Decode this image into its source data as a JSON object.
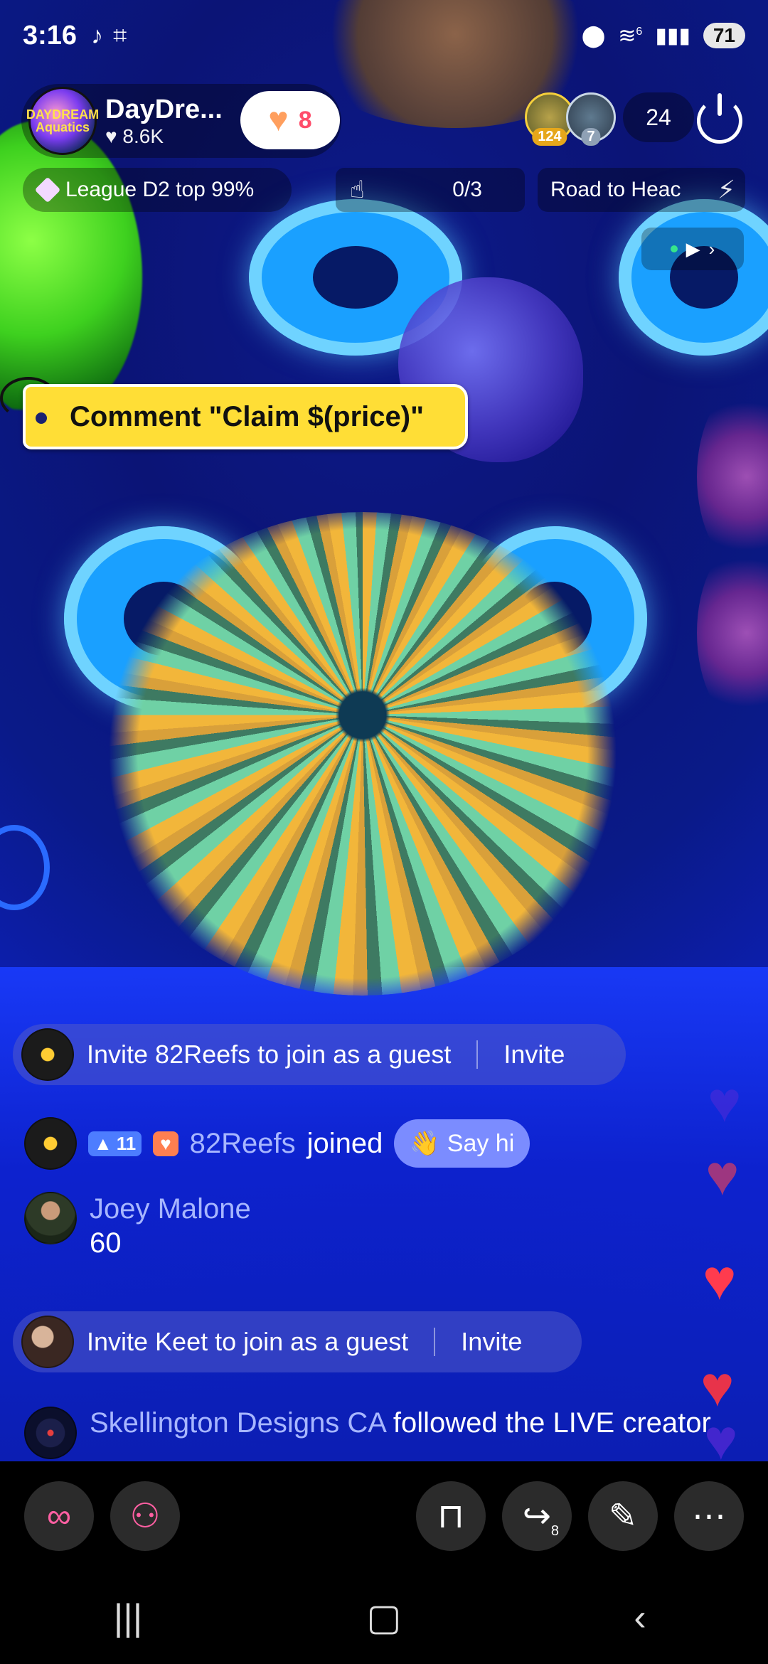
{
  "status_bar": {
    "time": "3:16",
    "wifi_label": "6",
    "battery": "71",
    "icons": [
      "tiktok-icon",
      "screenshot-icon",
      "location-icon",
      "wifi-icon",
      "signal-icon",
      "battery-icon"
    ]
  },
  "host": {
    "name": "DayDre...",
    "likes": "8.6K",
    "follow_count": "8",
    "avatar_text": "DAYDREAM Aquatics"
  },
  "viewers": {
    "top1_badge": "124",
    "top2_badge": "7",
    "count": "24"
  },
  "info_bar": {
    "league": "League D2 top 99%",
    "goal": "0/3",
    "road": "Road to Heac"
  },
  "claim_tag": "Comment \"Claim $(price)\"",
  "chat": {
    "invite1": {
      "text": "Invite 82Reefs to join as a guest",
      "button": "Invite"
    },
    "joined": {
      "level": "11",
      "name": "82Reefs",
      "action": "joined",
      "say_hi": "Say hi"
    },
    "joey": {
      "name": "Joey Malone",
      "message": "60"
    },
    "invite2": {
      "text": "Invite Keet to join as a guest",
      "button": "Invite"
    },
    "followed": {
      "name": "Skellington Designs CA",
      "action": "followed the LIVE creator"
    }
  },
  "toolbar": {
    "share_badge": "8",
    "buttons": [
      "link-icon",
      "people-icon",
      "shopping-bag-icon",
      "share-icon",
      "magic-wand-icon",
      "more-icon"
    ]
  },
  "colors": {
    "claim_tag": "#ffde36",
    "muted_name": "#a7b6ff",
    "heart": "#ff3b4e"
  }
}
